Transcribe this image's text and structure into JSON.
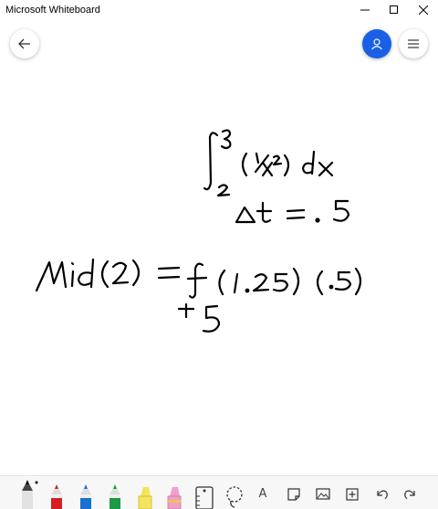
{
  "window": {
    "title": "Microsoft Whiteboard"
  },
  "toolbar": {
    "text_tool_glyph": "A"
  },
  "icons": {
    "back": "arrow-left-icon",
    "profile": "person-icon",
    "menu": "hamburger-icon",
    "minimize": "minimize-icon",
    "maximize": "maximize-icon",
    "close": "close-icon"
  },
  "colors": {
    "accent": "#1a5fe6",
    "ink": "#000000",
    "pen_red": "#d42020",
    "pen_blue": "#1a6fd0",
    "pen_green": "#1c9a45",
    "highlighter_yellow": "#f4e45a",
    "highlighter_pink": "#f0a0c8"
  }
}
